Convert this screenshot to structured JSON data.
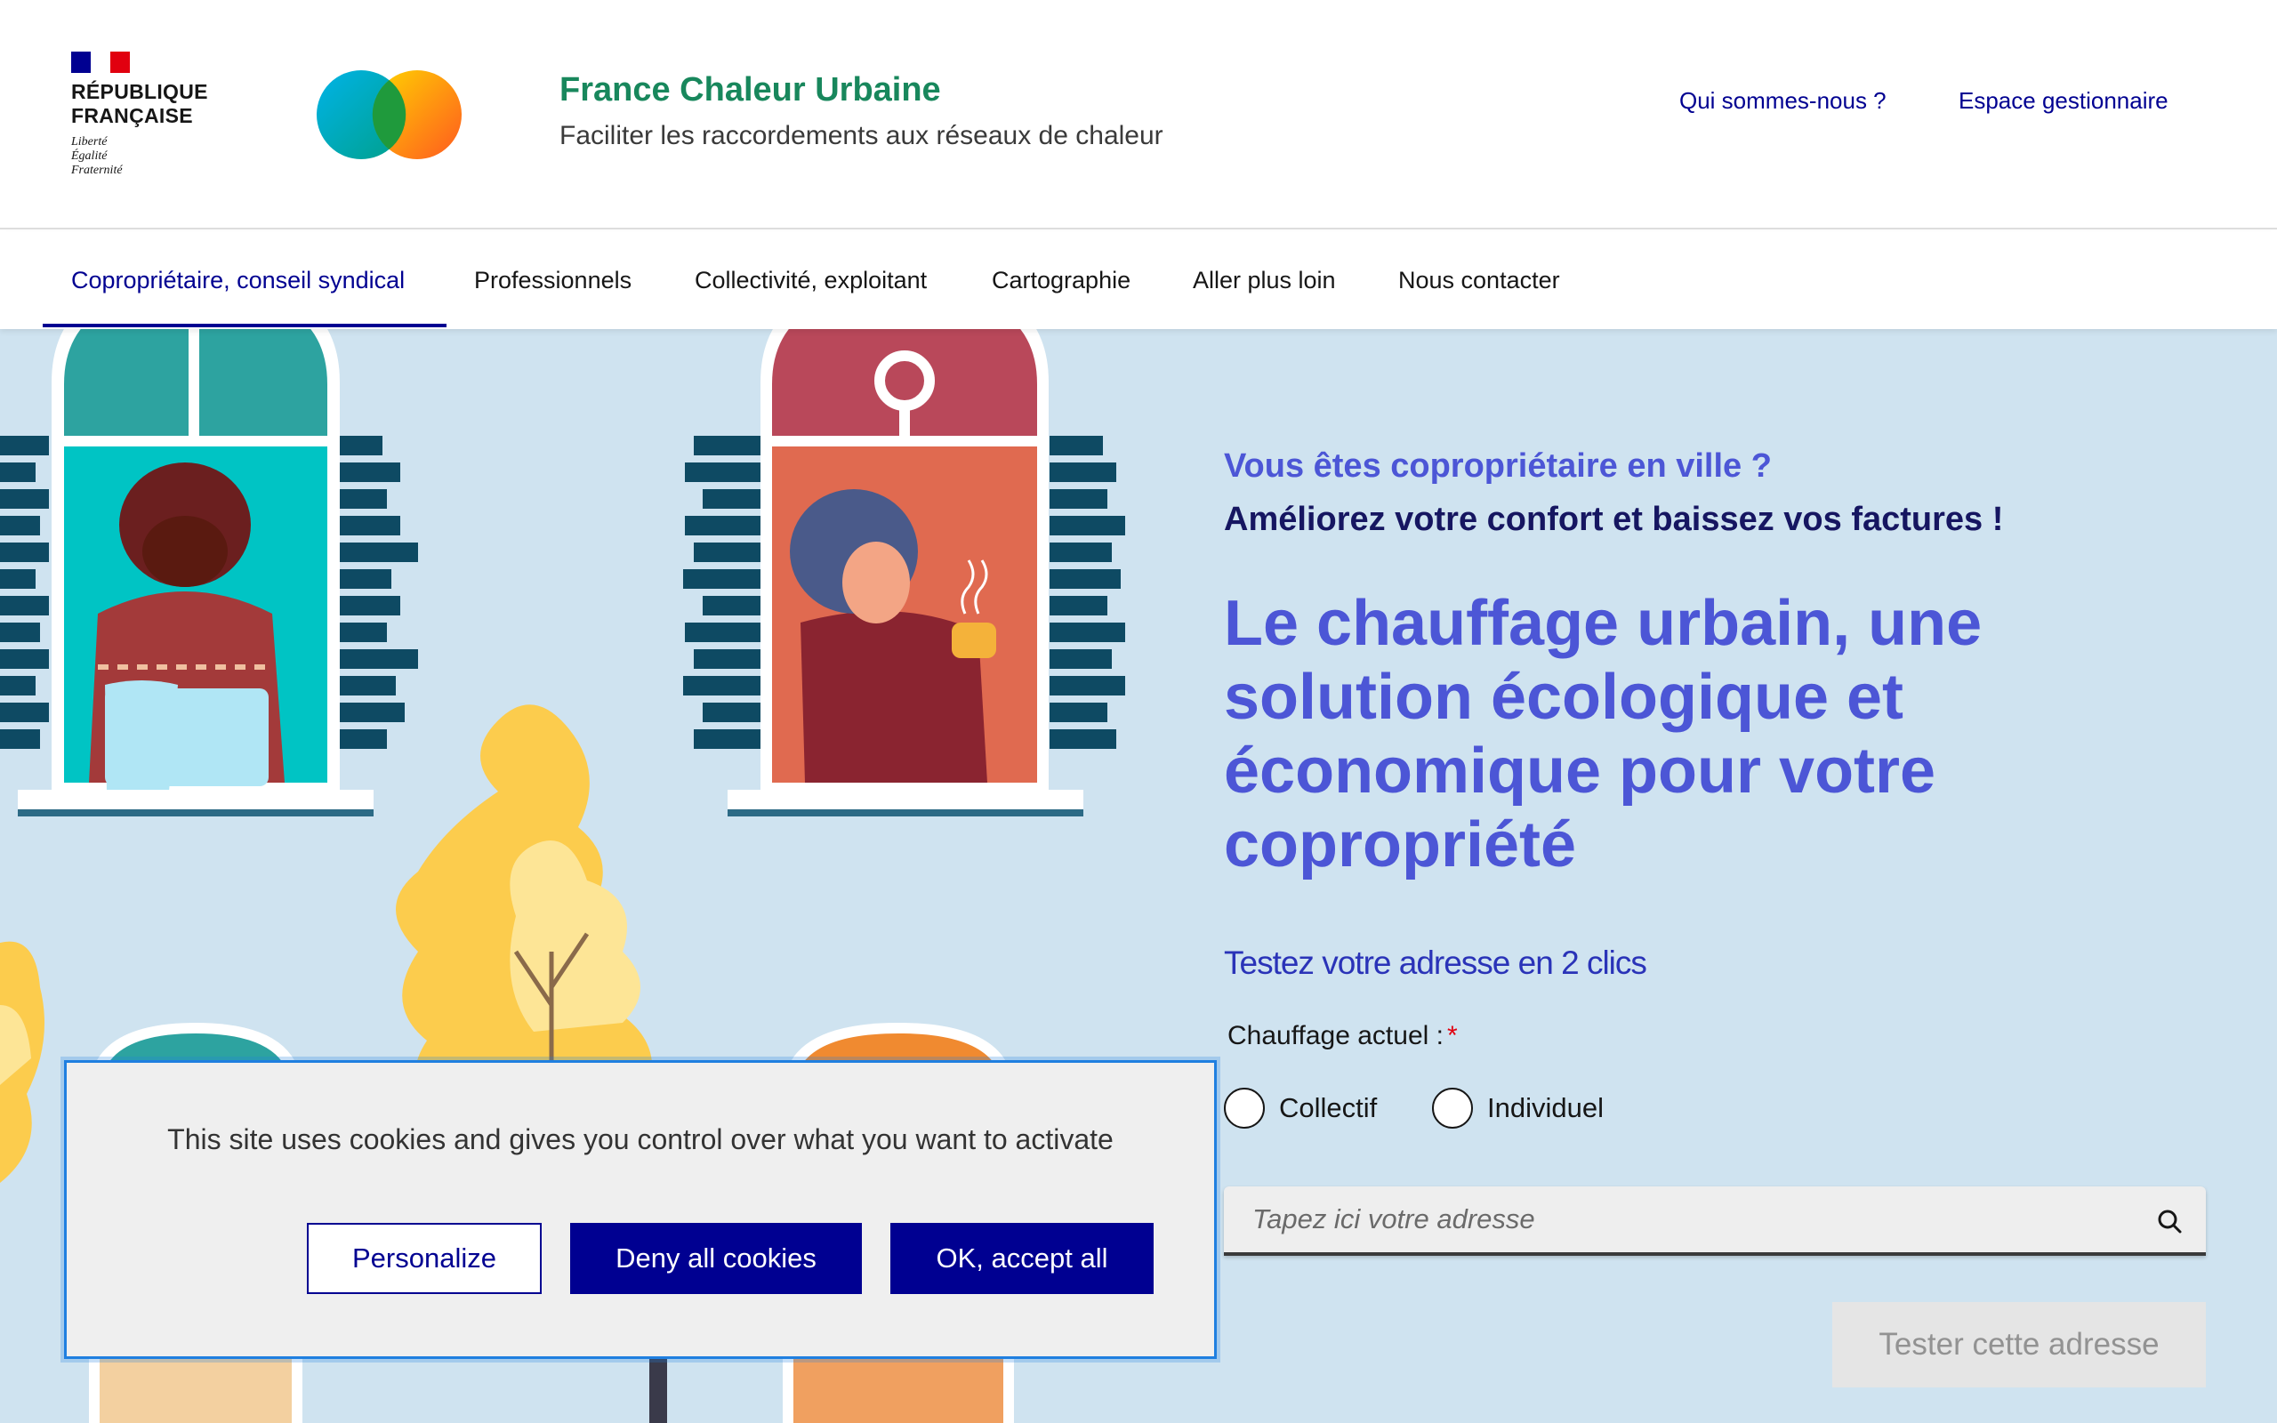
{
  "header": {
    "republic_name_line1": "RÉPUBLIQUE",
    "republic_name_line2": "FRANÇAISE",
    "devise_line1": "Liberté",
    "devise_line2": "Égalité",
    "devise_line3": "Fraternité",
    "brand_title": "France Chaleur Urbaine",
    "brand_tagline": "Faciliter les raccordements aux réseaux de chaleur",
    "links": [
      "Qui sommes-nous ?",
      "Espace gestionnaire"
    ]
  },
  "nav": {
    "items": [
      "Copropriétaire, conseil syndical",
      "Professionnels",
      "Collectivité, exploitant",
      "Cartographie",
      "Aller plus loin",
      "Nous contacter"
    ],
    "active_index": 0
  },
  "hero": {
    "subtitle_blue": "Vous êtes copropriétaire en ville ?",
    "subtitle_dark": "Améliorez votre confort et baissez vos factures !",
    "headline": "Le chauffage urbain, une solution écologique et économique pour votre copropriété",
    "test_title": "Testez votre adresse en 2 clics",
    "heating_label": "Chauffage actuel :",
    "required_mark": "*",
    "radio_options": [
      "Collectif",
      "Individuel"
    ],
    "address_placeholder": "Tapez ici votre adresse",
    "test_button": "Tester cette adresse"
  },
  "cookie_banner": {
    "text": "This site uses cookies and gives you control over what you want to activate",
    "personalize": "Personalize",
    "deny": "Deny all cookies",
    "accept": "OK, accept all"
  },
  "colors": {
    "brand_green": "#18875c",
    "dsfr_blue": "#000091",
    "hero_blue": "#4c56d6",
    "hero_bg": "#cfe3f0",
    "marianne_red": "#e1000f"
  },
  "icons": [
    "marianne-flag-icon",
    "brand-logo-icon",
    "search-icon"
  ]
}
